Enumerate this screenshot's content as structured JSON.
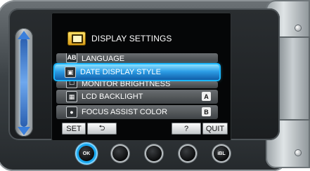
{
  "header": {
    "title": "DISPLAY SETTINGS",
    "icon": "display-settings-icon"
  },
  "menu": {
    "items": [
      {
        "label": "LANGUAGE",
        "icon": "language-icon",
        "icon_glyph": "AB"
      },
      {
        "label": "DATE DISPLAY STYLE",
        "icon": "date-style-icon",
        "icon_glyph": "▣",
        "selected": true
      },
      {
        "label": "MONITOR BRIGHTNESS",
        "icon": "brightness-icon",
        "icon_glyph": "☐"
      },
      {
        "label": "LCD BACKLIGHT",
        "icon": "backlight-icon",
        "icon_glyph": "▦",
        "value": "A"
      },
      {
        "label": "FOCUS ASSIST COLOR",
        "icon": "focus-assist-icon",
        "icon_glyph": "●",
        "value": "B"
      }
    ]
  },
  "softkeys": {
    "set": "SET",
    "back": "⮌",
    "help": "?",
    "quit": "QUIT"
  },
  "buttons": {
    "ok": "OK",
    "last": "iBL"
  },
  "colors": {
    "selection": "#2d9ee6",
    "selection_glow": "#1ab6ff",
    "slider": "#3a7fdc"
  }
}
